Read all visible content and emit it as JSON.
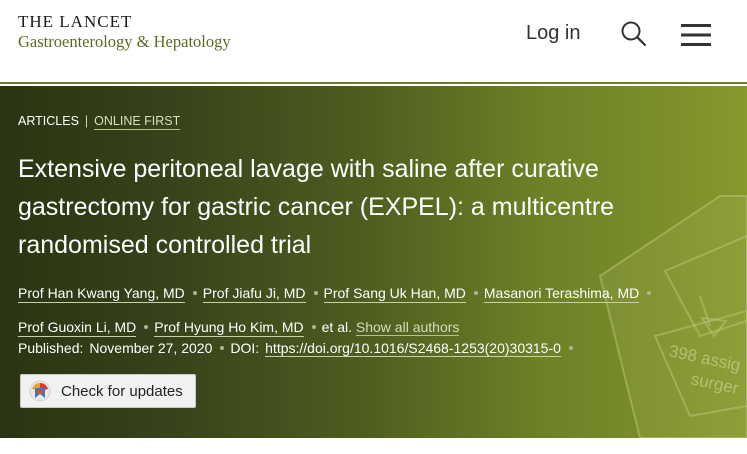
{
  "header": {
    "brand_title": "THE LANCET",
    "brand_subtitle": "Gastroenterology & Hepatology",
    "login_label": "Log in",
    "search_icon": "search-icon",
    "menu_icon": "hamburger-menu-icon"
  },
  "breadcrumb": {
    "section": "ARTICLES",
    "separator": "|",
    "status": "ONLINE FIRST"
  },
  "article": {
    "title": "Extensive peritoneal lavage with saline after curative gastrectomy for gastric cancer (EXPEL): a multicentre randomised controlled trial",
    "authors": [
      "Prof Han Kwang Yang, MD",
      "Prof Jiafu Ji, MD",
      "Prof Sang Uk Han, MD",
      "Masanori Terashima, MD",
      "Prof Guoxin Li, MD",
      "Prof Hyung Ho Kim, MD"
    ],
    "et_al": "et al.",
    "show_all_authors": "Show all authors",
    "published_label": "Published:",
    "published_date": "November 27, 2020",
    "doi_label": "DOI:",
    "doi_link": "https://doi.org/10.1016/S2468-1253(20)30315-0"
  },
  "hero_art": {
    "text_1": "398 assig",
    "text_2": "surger"
  },
  "updates_button": {
    "label": "Check for updates"
  },
  "colors": {
    "accent": "#6f7a2c",
    "hero_dark": "#2b3412",
    "hero_light": "#87982e"
  }
}
